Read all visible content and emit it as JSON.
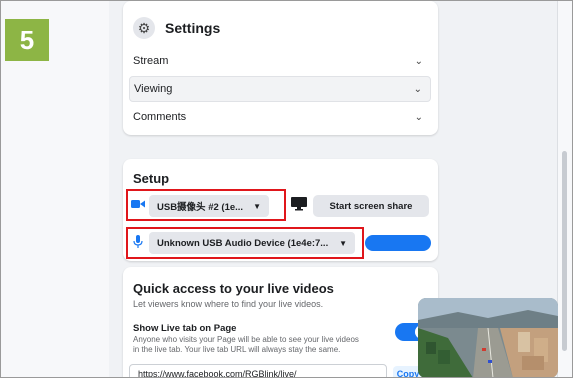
{
  "step_badge": "5",
  "settings": {
    "title": "Settings",
    "rows": [
      {
        "label": "Stream"
      },
      {
        "label": "Viewing"
      },
      {
        "label": "Comments"
      }
    ]
  },
  "setup": {
    "title": "Setup",
    "camera_value": "USB摄像头 #2 (1e...",
    "mic_value": "Unknown USB Audio Device (1e4e:7...",
    "screen_share_label": "Start screen share"
  },
  "quick_access": {
    "title": "Quick access to your live videos",
    "subtitle": "Let viewers know where to find your live videos.",
    "live_tab_title": "Show Live tab on Page",
    "live_tab_desc": "Anyone who visits your Page will be able to see your live videos in the live tab. Your live tab URL will always stay the same.",
    "url": "https://www.facebook.com/RGBlink/live/",
    "copy_label": "Copy",
    "toggle_on": true
  },
  "colors": {
    "accent": "#1877f2",
    "highlight": "#e0161b",
    "badge": "#8db545"
  },
  "icons": {
    "camera": "video-camera-icon",
    "mic": "microphone-icon",
    "monitor": "monitor-icon",
    "gear": "gear-icon",
    "chevron": "chevron-down-icon"
  }
}
